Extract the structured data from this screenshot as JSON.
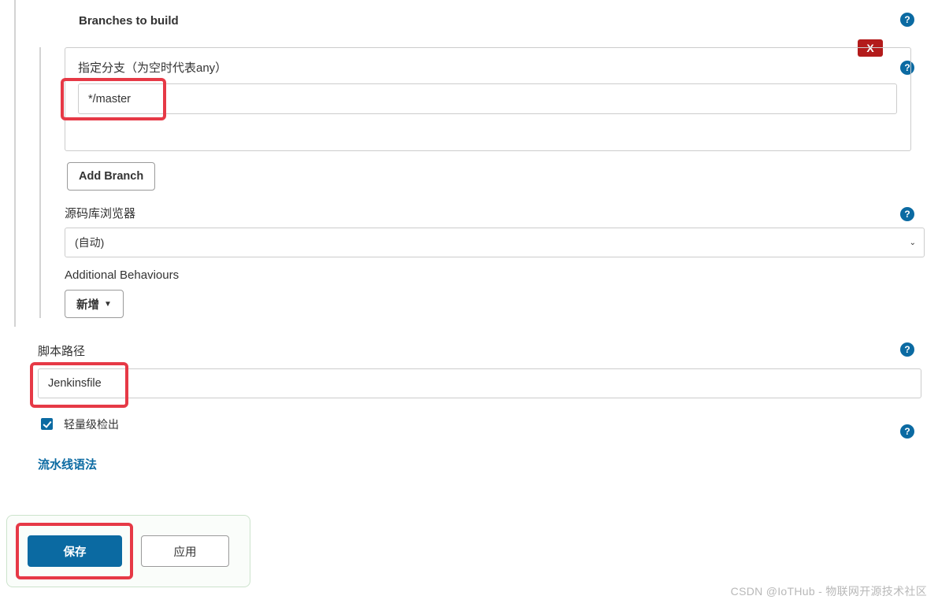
{
  "branches": {
    "title": "Branches to build",
    "branch_label": "指定分支（为空时代表any）",
    "branch_value": "*/master",
    "add_button": "Add Branch",
    "delete_glyph": "X"
  },
  "repo_browser": {
    "label": "源码库浏览器",
    "selected": "(自动)"
  },
  "additional_behaviours": {
    "label": "Additional Behaviours",
    "add_button": "新增"
  },
  "script_path": {
    "label": "脚本路径",
    "value": "Jenkinsfile"
  },
  "lightweight": {
    "label": "轻量级检出",
    "checked": true
  },
  "pipeline_syntax_link": "流水线语法",
  "actions": {
    "save": "保存",
    "apply": "应用"
  },
  "watermark": "CSDN @IoTHub - 物联网开源技术社区",
  "help_glyph": "?",
  "caret_glyph": "▼"
}
